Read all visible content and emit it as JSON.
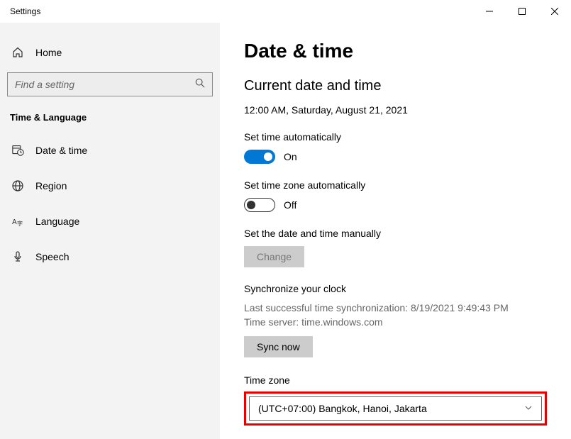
{
  "titlebar": {
    "title": "Settings"
  },
  "sidebar": {
    "home_label": "Home",
    "search_placeholder": "Find a setting",
    "section_title": "Time & Language",
    "items": [
      {
        "label": "Date & time"
      },
      {
        "label": "Region"
      },
      {
        "label": "Language"
      },
      {
        "label": "Speech"
      }
    ]
  },
  "main": {
    "title": "Date & time",
    "subtitle": "Current date and time",
    "current_datetime": "12:00 AM, Saturday, August 21, 2021",
    "auto_time": {
      "label": "Set time automatically",
      "state": "On"
    },
    "auto_tz": {
      "label": "Set time zone automatically",
      "state": "Off"
    },
    "manual": {
      "label": "Set the date and time manually",
      "button": "Change"
    },
    "sync": {
      "title": "Synchronize your clock",
      "last_sync_label": "Last successful time synchronization: ",
      "last_sync_value": "8/19/2021 9:49:43 PM",
      "server_label": "Time server: ",
      "server_value": "time.windows.com",
      "button": "Sync now"
    },
    "tz": {
      "label": "Time zone",
      "value": "(UTC+07:00) Bangkok, Hanoi, Jakarta"
    }
  }
}
